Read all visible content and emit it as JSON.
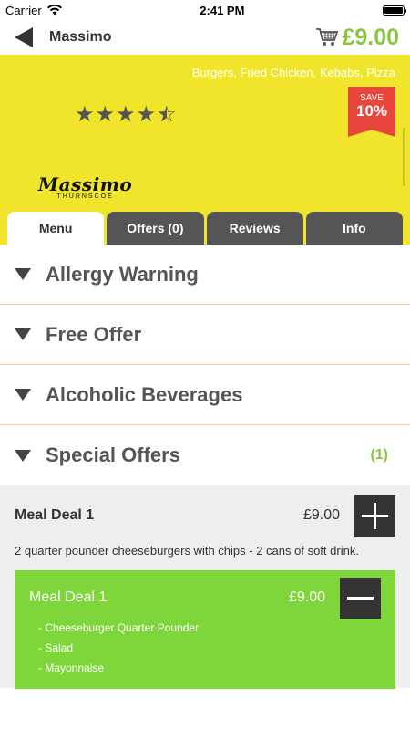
{
  "status": {
    "carrier": "Carrier",
    "time": "2:41 PM"
  },
  "nav": {
    "title": "Massimo",
    "cart_total": "£9.00"
  },
  "restaurant": {
    "cuisines": "Burgers, Fried Chicken, Kebabs, Pizza",
    "rating": 4.5,
    "rating_max": 5,
    "save_badge": {
      "label": "SAVE",
      "value": "10%"
    },
    "logo": {
      "name": "Massimo",
      "subtitle": "THURNSCOE"
    }
  },
  "tabs": [
    {
      "label": "Menu",
      "active": true
    },
    {
      "label": "Offers (0)",
      "active": false
    },
    {
      "label": "Reviews",
      "active": false
    },
    {
      "label": "Info",
      "active": false
    }
  ],
  "sections": [
    {
      "title": "Allergy Warning",
      "count": ""
    },
    {
      "title": "Free Offer",
      "count": ""
    },
    {
      "title": "Alcoholic Beverages",
      "count": ""
    },
    {
      "title": "Special Offers",
      "count": "(1)"
    }
  ],
  "offer_item": {
    "name": "Meal Deal 1",
    "price": "£9.00",
    "description": "2 quarter pounder cheeseburgers with chips - 2 cans of soft drink."
  },
  "selected_item": {
    "name": "Meal Deal 1",
    "price": "£9.00",
    "options": [
      "- Cheeseburger Quarter Pounder",
      "- Salad",
      "- Mayonnaise"
    ]
  },
  "colors": {
    "accent": "#8cc63f",
    "hero_bg": "#f0e52a",
    "badge": "#e8463c",
    "selected_bg": "#7fd63a",
    "tab_inactive": "#555555"
  }
}
